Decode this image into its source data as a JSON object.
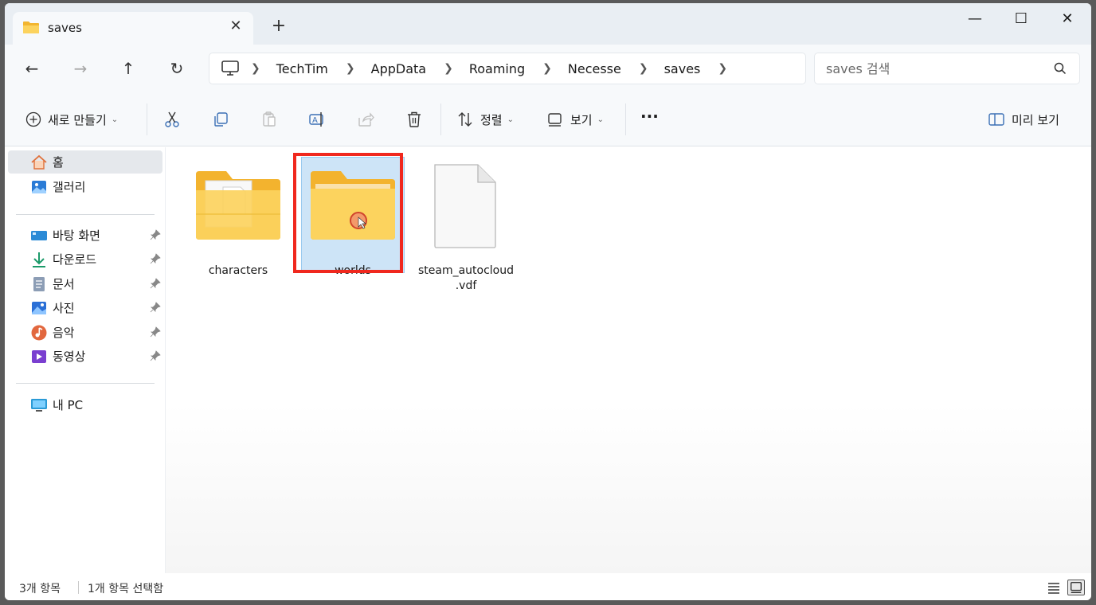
{
  "tab": {
    "title": "saves",
    "close": "✕",
    "new": "+"
  },
  "window_controls": {
    "minimize": "—",
    "maximize": "☐",
    "close": "✕"
  },
  "nav": {
    "back": "←",
    "forward": "→",
    "up": "↑",
    "refresh": "↻"
  },
  "breadcrumb": [
    "TechTim",
    "AppData",
    "Roaming",
    "Necesse",
    "saves"
  ],
  "search": {
    "placeholder": "saves 검색"
  },
  "toolbar": {
    "new_label": "새로 만들기",
    "sort_label": "정렬",
    "view_label": "보기",
    "more": "···",
    "preview_label": "미리 보기"
  },
  "sidebar": {
    "home": "홈",
    "gallery": "갤러리",
    "pinned": [
      {
        "label": "바탕 화면",
        "icon": "desktop-icon"
      },
      {
        "label": "다운로드",
        "icon": "download-icon"
      },
      {
        "label": "문서",
        "icon": "document-icon"
      },
      {
        "label": "사진",
        "icon": "pictures-icon"
      },
      {
        "label": "음악",
        "icon": "music-icon"
      },
      {
        "label": "동영상",
        "icon": "video-icon"
      }
    ],
    "this_pc": "내 PC"
  },
  "files": [
    {
      "name": "characters",
      "type": "folder"
    },
    {
      "name": "worlds",
      "type": "folder",
      "selected": true
    },
    {
      "name": "steam_autocloud\n.vdf",
      "type": "file"
    }
  ],
  "status": {
    "count": "3개 항목",
    "selected": "1개 항목 선택함"
  },
  "colors": {
    "highlight": "#f0281e",
    "selection": "#cde4f7",
    "folder": "#f7c44a"
  }
}
